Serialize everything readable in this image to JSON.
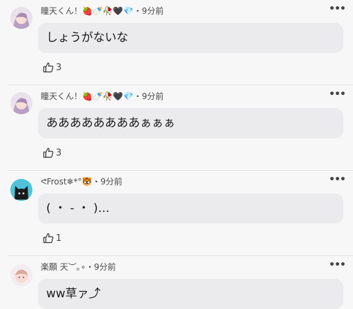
{
  "comments": [
    {
      "user": "瞳天くん！",
      "badges": "🍓🍼🥀🖤💎",
      "time": "9分前",
      "text": "しょうがないな",
      "likes": "3"
    },
    {
      "user": "瞳天くん！",
      "badges": "🍓🍼🥀🖤💎",
      "time": "9分前",
      "text": "ああああああああぁぁぁ",
      "likes": "3"
    },
    {
      "user": "ᕙFrost❄*°",
      "badges": "🐯",
      "time": "9分前",
      "text": "( ・ - ・ )…",
      "likes": "1"
    },
    {
      "user": "楽願 天︶｡∘",
      "badges": "",
      "time": "9分前",
      "text": "ww草ァ⤴",
      "likes": ""
    }
  ],
  "separator": "・",
  "more_label": "•••"
}
